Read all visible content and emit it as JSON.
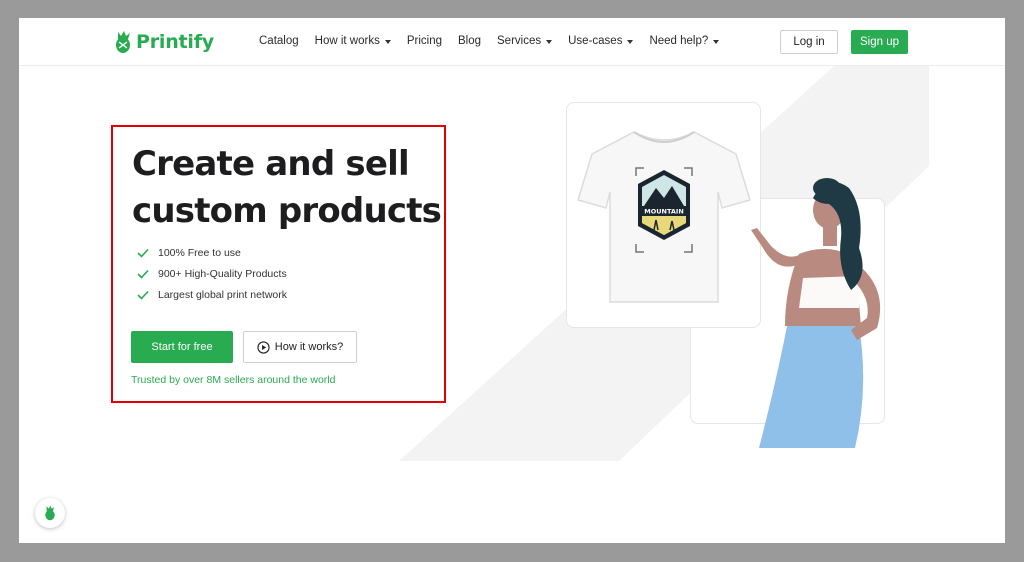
{
  "brand": {
    "name": "Printify",
    "color": "#29ab51"
  },
  "nav": [
    {
      "label": "Catalog",
      "dropdown": false
    },
    {
      "label": "How it works",
      "dropdown": true
    },
    {
      "label": "Pricing",
      "dropdown": false
    },
    {
      "label": "Blog",
      "dropdown": false
    },
    {
      "label": "Services",
      "dropdown": true
    },
    {
      "label": "Use-cases",
      "dropdown": true
    },
    {
      "label": "Need help?",
      "dropdown": true
    }
  ],
  "auth": {
    "login": "Log in",
    "signup": "Sign up"
  },
  "hero": {
    "title_line1": "Create and sell",
    "title_line2": "custom products",
    "features": [
      "100% Free to use",
      "900+ High-Quality Products",
      "Largest global print network"
    ],
    "cta_primary": "Start for free",
    "cta_secondary": "How it works?",
    "trusted": "Trusted by over 8M sellers around the world"
  },
  "illustration": {
    "badge_text": "MOUNTAIN",
    "icons": [
      "tshirt-illustration",
      "woman-illustration",
      "play-icon",
      "check-icon",
      "chat-widget-icon"
    ]
  },
  "colors": {
    "accent": "#29ab51",
    "highlight_border": "#e00000",
    "skirt": "#8ec0ea",
    "hair": "#1f3a44",
    "skin": "#b98a80"
  }
}
